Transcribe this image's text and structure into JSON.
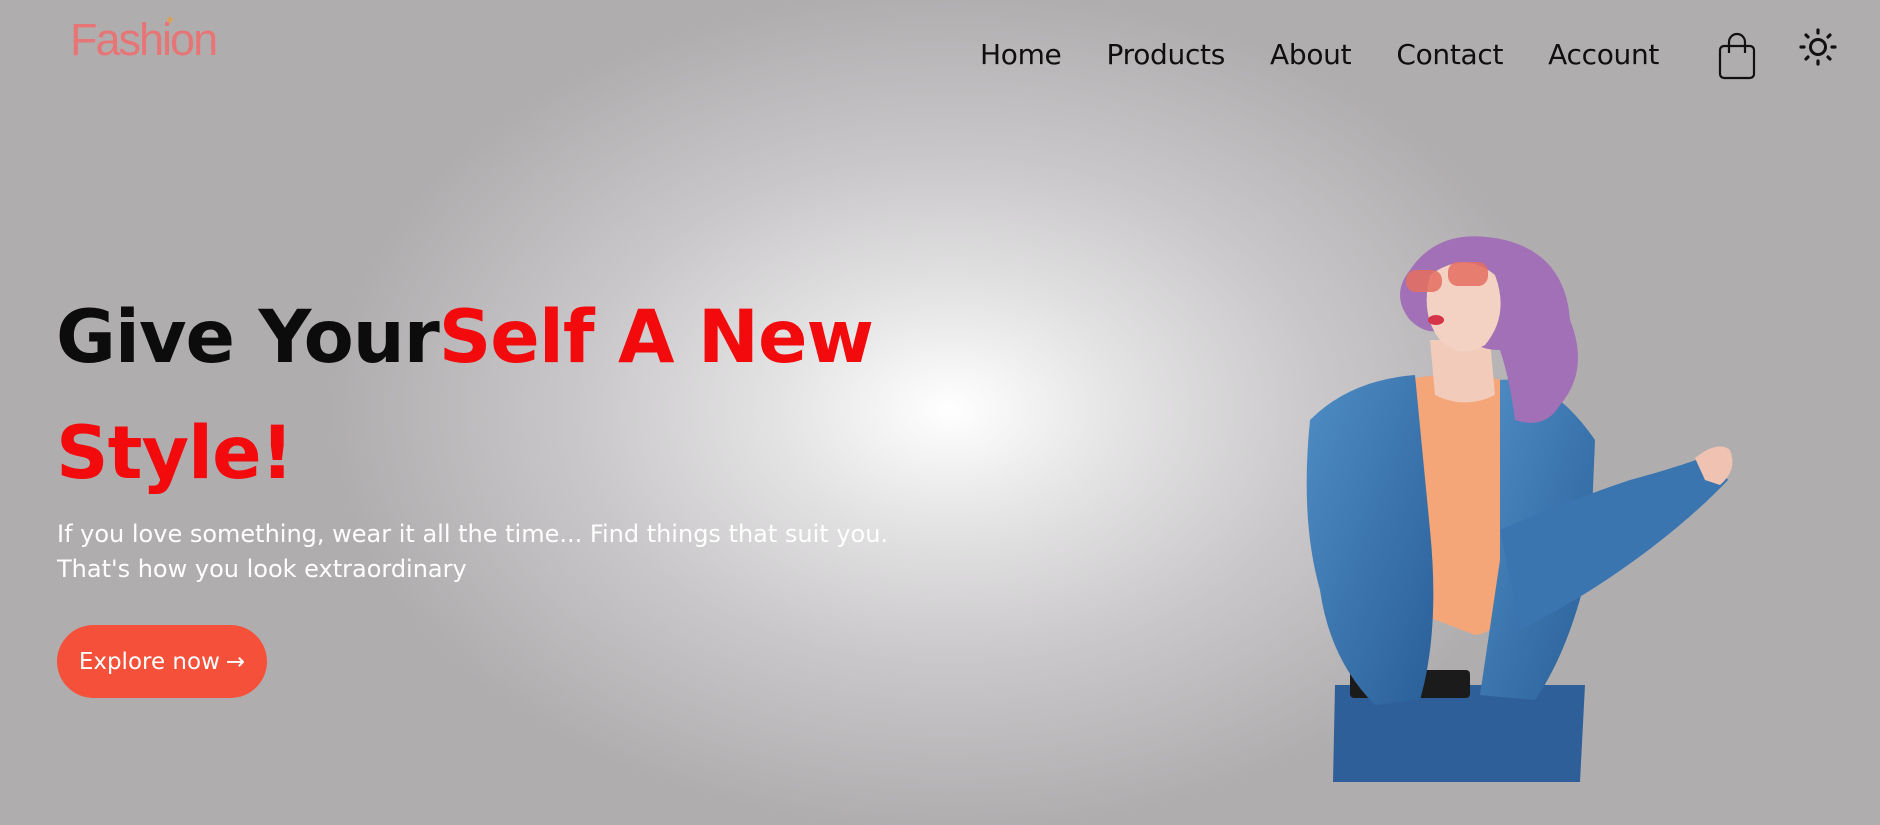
{
  "logo": {
    "text": "Fashion",
    "spark": "✦"
  },
  "nav": {
    "items": [
      {
        "label": "Home"
      },
      {
        "label": "Products"
      },
      {
        "label": "About"
      },
      {
        "label": "Contact"
      },
      {
        "label": "Account"
      }
    ],
    "icons": [
      "shopping-bag-icon",
      "theme-toggle-sun-icon"
    ]
  },
  "hero": {
    "title_part1": "Give Your",
    "title_part2": "Self A New",
    "title_line2": "Style!",
    "description_line1": "If you love something, wear it all the time... Find things that suit you.",
    "description_line2": "That's how you look extraordinary",
    "cta_label": "Explore now",
    "cta_arrow": "→"
  },
  "colors": {
    "logo": "#e87575",
    "accent_red": "#f20a0c",
    "button": "#f5503a",
    "text_dark": "#0c0c0c",
    "description": "#ffffff"
  }
}
